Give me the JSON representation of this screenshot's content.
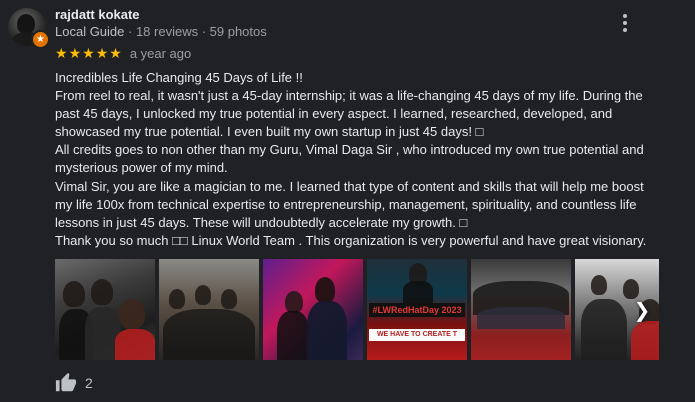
{
  "reviewer": {
    "name": "rajdatt kokate",
    "badge": "Local Guide",
    "stats": "· 18 reviews · 59 photos"
  },
  "rating": {
    "stars": 5,
    "max": 5,
    "date": "a year ago"
  },
  "review": {
    "paragraphs": [
      "Incredibles Life Changing 45 Days of Life !!",
      "From reel to real, it wasn't just a 45-day internship; it was a life-changing 45 days of my life. During the past 45 days, I unlocked my true potential in every aspect. I learned, researched, developed, and showcased my true potential. I even built my own startup in just 45 days! □",
      "All credits goes to non other than my Guru, Vimal Daga Sir , who introduced my own true potential and mysterious power of my mind.",
      "Vimal Sir, you are like a magician to me. I learned that type of content and skills that will help me boost my life 100x from technical expertise to entrepreneurship, management, spirituality, and countless life lessons in just 45 days. These will undoubtedly accelerate my growth. □",
      "Thank you so much □□ Linux World Team . This organization is very powerful and have great visionary."
    ]
  },
  "photos": {
    "banner_text": "#LWRedHatDay 2023",
    "banner_sub": "WE HAVE TO CREATE T"
  },
  "likes": {
    "count": "2"
  },
  "colors": {
    "star": "#fbbc04",
    "badge": "#e37400",
    "background": "#202124"
  },
  "icons": {
    "menu": "more-vert-icon",
    "like": "thumb-up-icon",
    "next": "chevron-right-icon",
    "badge": "local-guide-star-icon"
  }
}
